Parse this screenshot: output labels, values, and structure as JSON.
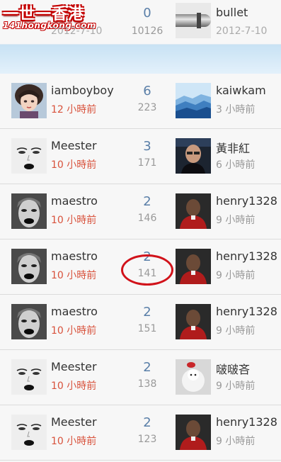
{
  "logo": {
    "line1": "一世一香港",
    "line2": "141hongkong.com"
  },
  "top_row": {
    "date1": "2012-7-10",
    "replies": "0",
    "views": "10126",
    "user2": "bullet",
    "date2": "2012-7-10"
  },
  "threads": [
    {
      "user1": "iamboyboy",
      "time1": "12 小時前",
      "replies": "6",
      "views": "223",
      "user2": "kaiwkam",
      "time2": "3 小時前"
    },
    {
      "user1": "Meester",
      "time1": "10 小時前",
      "replies": "3",
      "views": "171",
      "user2": "黃非紅",
      "time2": "6 小時前"
    },
    {
      "user1": "maestro",
      "time1": "10 小時前",
      "replies": "2",
      "views": "146",
      "user2": "henry1328",
      "time2": "9 小時前"
    },
    {
      "user1": "maestro",
      "time1": "10 小時前",
      "replies": "2",
      "views": "141",
      "user2": "henry1328",
      "time2": "9 小時前"
    },
    {
      "user1": "maestro",
      "time1": "10 小時前",
      "replies": "2",
      "views": "151",
      "user2": "henry1328",
      "time2": "9 小時前"
    },
    {
      "user1": "Meester",
      "time1": "10 小時前",
      "replies": "2",
      "views": "138",
      "user2": "啵啵吝",
      "time2": "9 小時前"
    },
    {
      "user1": "Meester",
      "time1": "10 小時前",
      "replies": "2",
      "views": "123",
      "user2": "henry1328",
      "time2": "9 小時前"
    }
  ],
  "colors": {
    "accent_red": "#d8523c",
    "count_blue": "#5a7fa8",
    "annotation_red": "#d1121a"
  }
}
